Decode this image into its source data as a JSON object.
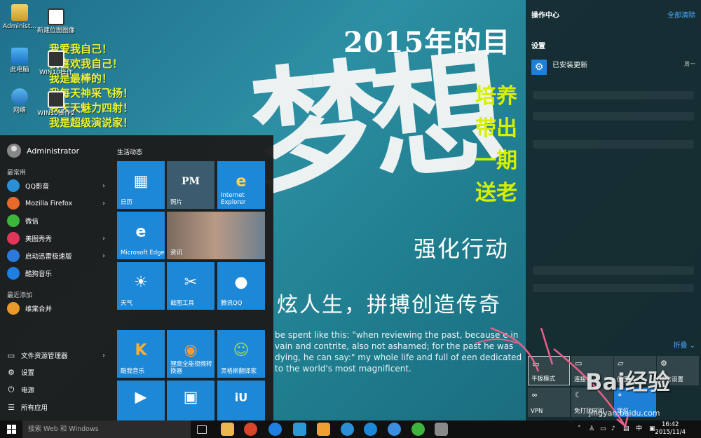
{
  "wallpaper": {
    "year_title": "2015年的目",
    "dream": "梦想",
    "strong": "强化行动",
    "motto": "炫人生，拼搏创造传奇",
    "quote": "be spent like this: \"when reviewing the past, because e in vain and contrite, also not ashamed; for the past he was dying, he can say:\" my whole life and full of een dedicated to the world's most magnificent.",
    "green_lines": [
      "培养",
      "带出",
      "一期",
      "送老"
    ],
    "yellow_lines": [
      "我爱我自己！",
      "我喜欢我自己！",
      "我是最棒的！",
      "我每天神采飞扬！",
      "我天天魅力四射！",
      "我是超级演说家！"
    ]
  },
  "desktop_icons": [
    {
      "label": "Administ...",
      "icon": "user-folder-icon"
    },
    {
      "label": "新建位图图像",
      "icon": "bitmap-icon"
    },
    {
      "label": "此电脑",
      "icon": "computer-icon"
    },
    {
      "label": "WIN10操作",
      "icon": "file-icon"
    },
    {
      "label": "网络",
      "icon": "network-icon"
    },
    {
      "label": "WIN10操作2",
      "icon": "file-icon"
    }
  ],
  "start_menu": {
    "user": "Administrator",
    "most_used_label": "最常用",
    "most_used": [
      {
        "label": "QQ影音",
        "color": "#2a8fd6",
        "arrow": true
      },
      {
        "label": "Mozilla Firefox",
        "color": "#e8692a",
        "arrow": true
      },
      {
        "label": "微信",
        "color": "#3db53d",
        "arrow": false
      },
      {
        "label": "美图秀秀",
        "color": "#e0365a",
        "arrow": true
      },
      {
        "label": "启动迅雷极速版",
        "color": "#2b79d8",
        "arrow": true
      },
      {
        "label": "酷狗音乐",
        "color": "#1f7fe0",
        "arrow": false
      }
    ],
    "recent_label": "最近添加",
    "recent": [
      {
        "label": "维棠合并",
        "color": "#e89a2a"
      }
    ],
    "system": [
      {
        "label": "文件资源管理器",
        "glyph": "▭",
        "arrow": true
      },
      {
        "label": "设置",
        "glyph": "⚙",
        "arrow": false
      },
      {
        "label": "电源",
        "glyph": "⏻",
        "arrow": false
      },
      {
        "label": "所有应用",
        "glyph": "☰",
        "arrow": false
      }
    ],
    "tiles_label": "生活动态",
    "tiles": [
      {
        "label": "日历",
        "glyph": "▦"
      },
      {
        "label": "照片",
        "glyph": "PM"
      },
      {
        "label": "Internet\nExplorer",
        "glyph": "e"
      },
      {
        "label": "Microsoft Edge",
        "glyph": "e"
      },
      {
        "label": "资讯",
        "glyph": ""
      },
      {
        "label": "天气",
        "glyph": "☀"
      },
      {
        "label": "截图工具",
        "glyph": "✂"
      },
      {
        "label": "腾讯QQ",
        "glyph": "🐧"
      },
      {
        "label": "酷我音乐",
        "glyph": "K"
      },
      {
        "label": "狸窝全能视频转换器",
        "glyph": "◉"
      },
      {
        "label": "灵格斯翻译家",
        "glyph": "☺"
      },
      {
        "label": "",
        "glyph": "▶"
      },
      {
        "label": "",
        "glyph": "▣"
      },
      {
        "label": "",
        "glyph": "iU"
      }
    ]
  },
  "action_center": {
    "title": "操作中心",
    "clear_all": "全部清除",
    "settings_label": "设置",
    "notification": {
      "text": "已安装更新",
      "day": "周一"
    },
    "collapse": "折叠",
    "quick_actions": [
      {
        "label": "平板模式",
        "glyph": "▭"
      },
      {
        "label": "连接",
        "glyph": "▭"
      },
      {
        "label": "便签",
        "glyph": "▱"
      },
      {
        "label": "所有设置",
        "glyph": "⚙"
      },
      {
        "label": "VPN",
        "glyph": "∞"
      },
      {
        "label": "免打扰时间",
        "glyph": "☾"
      },
      {
        "label": "定位",
        "glyph": "⌖"
      }
    ]
  },
  "taskbar": {
    "search_placeholder": "搜索 Web 和 Windows",
    "tray_lang": "中",
    "time": "16:42",
    "date": "2015/11/4"
  },
  "watermark": {
    "text": "Bai经验",
    "url": "jingyan.baidu.com"
  },
  "colors": {
    "tile_blue": "#1e88d8",
    "accent_blue": "#1e7fd7",
    "link_blue": "#4aa8ff",
    "taskbar": "#101010"
  }
}
